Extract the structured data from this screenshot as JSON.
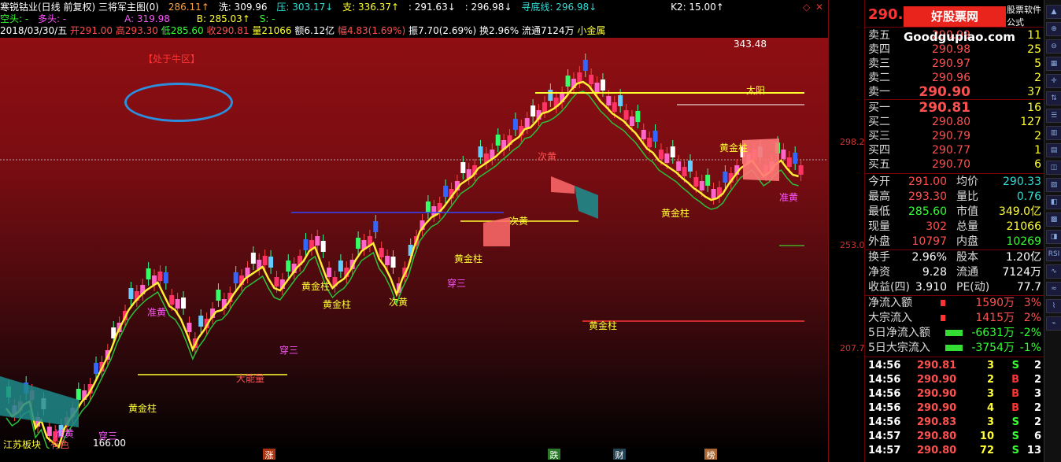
{
  "header": {
    "stock_name": "寒锐钴业(日线 前复权) 三将军主图(0)",
    "ma1_label": "286.11↑",
    "xi_label": "洗: 309.96",
    "ya_label": "压: 303.17↓",
    "zhi_label": "支: 336.37↑",
    "v1": ": 291.63↓",
    "v2": ": 296.98↓",
    "xundi_label": "寻底线: 296.98↓",
    "k2_label": "K2: 15.00↑",
    "kongtou": "空头: -",
    "duotou": "多头: -",
    "a_label": "A: 319.98",
    "b_label": "B: 285.03↑",
    "s_label": "S: -",
    "date": "2018/03/30/五",
    "open": "开291.00",
    "high": "高293.30",
    "low": "低285.60",
    "close": "收290.81",
    "volume": "量21066",
    "amount": "额6.12亿",
    "amplitude_pct": "幅4.83(1.69%)",
    "swing": "振7.70(2.69%)",
    "turnover": "换2.96%",
    "float": "流通7124万",
    "sector": "小金属"
  },
  "annotations": {
    "bull_zone": "【处于牛区】",
    "peak": "343.48",
    "low_mark": "166.00",
    "labels": [
      "黄金柱",
      "黄金柱",
      "黄金柱",
      "黄金柱",
      "黄金柱",
      "黄金柱",
      "黄金柱",
      "次黄",
      "次黄",
      "次黄",
      "穿三",
      "穿三",
      "穿三",
      "准黄",
      "准黄",
      "准黄",
      "太阳",
      "大能量"
    ]
  },
  "price_axis": {
    "ticks": [
      "298.2",
      "253.0",
      "207.7"
    ]
  },
  "bottom": {
    "sector_name": "江苏板块",
    "color_label": "有色",
    "markers": [
      "涨",
      "跌",
      "财",
      "榜"
    ]
  },
  "quote": {
    "current_price": "290.8",
    "logo_text": "好股票网Goodgupiao.com",
    "software_label": "股票软件公式",
    "asks": [
      {
        "label": "卖五",
        "price": "290.99",
        "vol": "11"
      },
      {
        "label": "卖四",
        "price": "290.98",
        "vol": "25"
      },
      {
        "label": "卖三",
        "price": "290.97",
        "vol": "5"
      },
      {
        "label": "卖二",
        "price": "290.96",
        "vol": "2"
      },
      {
        "label": "卖一",
        "price": "290.90",
        "vol": "37"
      }
    ],
    "bids": [
      {
        "label": "买一",
        "price": "290.81",
        "vol": "16"
      },
      {
        "label": "买二",
        "price": "290.80",
        "vol": "127"
      },
      {
        "label": "买三",
        "price": "290.79",
        "vol": "2"
      },
      {
        "label": "买四",
        "price": "290.77",
        "vol": "1"
      },
      {
        "label": "买五",
        "price": "290.70",
        "vol": "6"
      }
    ],
    "stats": [
      {
        "l1": "今开",
        "v1": "291.00",
        "l2": "均价",
        "v2": "290.33"
      },
      {
        "l1": "最高",
        "v1": "293.30",
        "l2": "量比",
        "v2": "0.76"
      },
      {
        "l1": "最低",
        "v1": "285.60",
        "l2": "市值",
        "v2": "349.0亿"
      },
      {
        "l1": "现量",
        "v1": "302",
        "l2": "总量",
        "v2": "21066"
      },
      {
        "l1": "外盘",
        "v1": "10797",
        "l2": "内盘",
        "v2": "10269"
      }
    ],
    "stats2": [
      {
        "l1": "换手",
        "v1": "2.96%",
        "l2": "股本",
        "v2": "1.20亿"
      },
      {
        "l1": "净资",
        "v1": "9.28",
        "l2": "流通",
        "v2": "7124万"
      },
      {
        "l1": "收益(四)",
        "v1": "3.910",
        "l2": "PE(动)",
        "v2": "77.7"
      }
    ],
    "flows": [
      {
        "label": "净流入额",
        "value": "1590万",
        "pct": "3%"
      },
      {
        "label": "大宗流入",
        "value": "1415万",
        "pct": "2%"
      },
      {
        "label": "5日净流入额",
        "value": "-6631万",
        "pct": "-2%"
      },
      {
        "label": "5日大宗流入",
        "value": "-3754万",
        "pct": "-1%"
      }
    ],
    "ticks": [
      {
        "time": "14:56",
        "price": "290.81",
        "vol": "3",
        "side": "S",
        "n": "2"
      },
      {
        "time": "14:56",
        "price": "290.90",
        "vol": "2",
        "side": "B",
        "n": "2"
      },
      {
        "time": "14:56",
        "price": "290.90",
        "vol": "3",
        "side": "B",
        "n": "3"
      },
      {
        "time": "14:56",
        "price": "290.90",
        "vol": "4",
        "side": "B",
        "n": "2"
      },
      {
        "time": "14:56",
        "price": "290.83",
        "vol": "3",
        "side": "S",
        "n": "2"
      },
      {
        "time": "14:57",
        "price": "290.80",
        "vol": "10",
        "side": "S",
        "n": "6"
      },
      {
        "time": "14:57",
        "price": "290.80",
        "vol": "72",
        "side": "S",
        "n": "13"
      }
    ]
  },
  "icons": [
    "arrow-up-icon",
    "zoom-in-icon",
    "zoom-out-icon",
    "grid-icon",
    "cross-icon",
    "sort-icon",
    "list-icon",
    "bar-icon",
    "table-icon",
    "chart-icon",
    "chart2-icon",
    "chart3-icon",
    "chart4-icon",
    "chart5-icon",
    "rsi-icon",
    "indicator-icon",
    "indicator2-icon",
    "indicator3-icon",
    "indicator4-icon"
  ],
  "icon_labels": {
    "rsi": "RSI"
  },
  "candles": [
    [
      230,
      505
    ],
    [
      225,
      515
    ],
    [
      228,
      510
    ],
    [
      242,
      500
    ],
    [
      253,
      496
    ],
    [
      255,
      530
    ],
    [
      265,
      520
    ],
    [
      270,
      542
    ],
    [
      275,
      548
    ],
    [
      272,
      554
    ],
    [
      290,
      530
    ],
    [
      300,
      518
    ],
    [
      312,
      508
    ],
    [
      320,
      496
    ],
    [
      322,
      488
    ],
    [
      330,
      475
    ],
    [
      340,
      460
    ],
    [
      350,
      445
    ],
    [
      365,
      430
    ],
    [
      372,
      410
    ],
    [
      375,
      395
    ],
    [
      385,
      380
    ],
    [
      392,
      370
    ],
    [
      395,
      362
    ],
    [
      405,
      355
    ],
    [
      415,
      350
    ],
    [
      420,
      345
    ],
    [
      425,
      360
    ],
    [
      432,
      375
    ],
    [
      438,
      380
    ],
    [
      442,
      392
    ],
    [
      446,
      410
    ],
    [
      450,
      430
    ],
    [
      455,
      415
    ],
    [
      460,
      405
    ],
    [
      468,
      392
    ],
    [
      475,
      382
    ],
    [
      480,
      380
    ],
    [
      488,
      372
    ],
    [
      495,
      360
    ],
    [
      500,
      350
    ],
    [
      505,
      340
    ],
    [
      512,
      335
    ],
    [
      518,
      330
    ],
    [
      522,
      325
    ],
    [
      528,
      340
    ],
    [
      530,
      352
    ],
    [
      538,
      355
    ],
    [
      545,
      345
    ],
    [
      552,
      335
    ],
    [
      558,
      325
    ],
    [
      562,
      318
    ],
    [
      566,
      305
    ],
    [
      570,
      300
    ],
    [
      575,
      320
    ],
    [
      580,
      340
    ],
    [
      585,
      352
    ],
    [
      590,
      345
    ],
    [
      595,
      340
    ],
    [
      600,
      330
    ],
    [
      608,
      316
    ],
    [
      612,
      305
    ],
    [
      618,
      300
    ],
    [
      625,
      295
    ],
    [
      630,
      315
    ],
    [
      636,
      325
    ],
    [
      640,
      340
    ],
    [
      646,
      360
    ],
    [
      650,
      340
    ],
    [
      656,
      325
    ],
    [
      662,
      300
    ],
    [
      668,
      280
    ],
    [
      675,
      270
    ],
    [
      680,
      262
    ],
    [
      686,
      258
    ],
    [
      692,
      250
    ],
    [
      700,
      240
    ],
    [
      705,
      230
    ],
    [
      712,
      220
    ],
    [
      718,
      215
    ],
    [
      722,
      210
    ],
    [
      728,
      200
    ],
    [
      732,
      195
    ],
    [
      738,
      190
    ],
    [
      745,
      185
    ],
    [
      752,
      178
    ],
    [
      760,
      172
    ],
    [
      765,
      165
    ],
    [
      770,
      160
    ],
    [
      775,
      150
    ],
    [
      780,
      148
    ],
    [
      785,
      140
    ],
    [
      790,
      130
    ],
    [
      795,
      128
    ],
    [
      800,
      124
    ],
    [
      805,
      118
    ],
    [
      810,
      110
    ],
    [
      818,
      100
    ],
    [
      824,
      92
    ],
    [
      830,
      90
    ],
    [
      836,
      95
    ],
    [
      842,
      105
    ],
    [
      848,
      115
    ],
    [
      852,
      122
    ],
    [
      858,
      130
    ],
    [
      862,
      135
    ],
    [
      868,
      140
    ],
    [
      872,
      148
    ],
    [
      878,
      155
    ],
    [
      884,
      165
    ],
    [
      890,
      175
    ],
    [
      895,
      180
    ],
    [
      900,
      190
    ],
    [
      905,
      195
    ],
    [
      910,
      200
    ],
    [
      915,
      205
    ],
    [
      920,
      212
    ],
    [
      925,
      218
    ],
    [
      930,
      225
    ],
    [
      936,
      230
    ],
    [
      942,
      236
    ],
    [
      948,
      240
    ],
    [
      952,
      238
    ],
    [
      958,
      232
    ],
    [
      962,
      220
    ],
    [
      968,
      210
    ],
    [
      972,
      200
    ],
    [
      978,
      195
    ],
    [
      982,
      190
    ],
    [
      988,
      200
    ],
    [
      992,
      210
    ],
    [
      996,
      205
    ],
    [
      1000,
      195
    ],
    [
      1004,
      190
    ],
    [
      1010,
      200
    ],
    [
      1016,
      208
    ],
    [
      1020,
      210
    ]
  ]
}
